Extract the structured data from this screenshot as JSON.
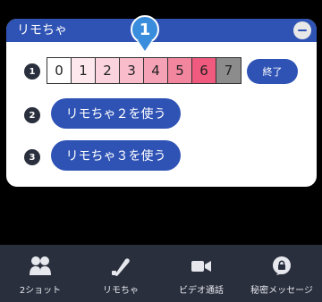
{
  "panel": {
    "title": "リモちゃ",
    "minimize_icon": "minus-circle-icon",
    "pointer_number": "1"
  },
  "steps": [
    "1",
    "2",
    "3"
  ],
  "scale": {
    "cells": [
      {
        "label": "0",
        "color": "#ffffff"
      },
      {
        "label": "1",
        "color": "#fde8ee"
      },
      {
        "label": "2",
        "color": "#fbd3de"
      },
      {
        "label": "3",
        "color": "#f9bccb"
      },
      {
        "label": "4",
        "color": "#f6a2b6"
      },
      {
        "label": "5",
        "color": "#f3869f"
      },
      {
        "label": "6",
        "color": "#ef5a7e"
      },
      {
        "label": "7",
        "color": "#8c8c8c"
      }
    ]
  },
  "buttons": {
    "end": "終了",
    "use2": "リモちゃ２を使う",
    "use3": "リモちゃ３を使う"
  },
  "toolbar": {
    "items": [
      {
        "label": "2ショット",
        "icon": "two-people-icon"
      },
      {
        "label": "リモちゃ",
        "icon": "remote-toy-icon"
      },
      {
        "label": "ビデオ通話",
        "icon": "video-camera-icon"
      },
      {
        "label": "秘密メッセージ",
        "icon": "lock-message-icon"
      }
    ]
  },
  "colors": {
    "accent": "#2f53b5",
    "toolbar_bg": "#2a2f3d",
    "pointer": "#3a8ddc"
  }
}
